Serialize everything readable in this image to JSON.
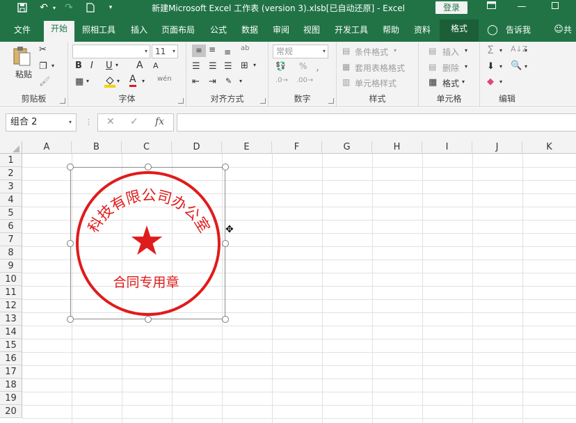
{
  "title_bar": {
    "title": "新建Microsoft Excel 工作表 (version 3).xlsb[已自动还原]  -  Excel",
    "login": "登录",
    "icons": [
      "save-icon",
      "undo-icon",
      "redo-icon",
      "new-document-icon",
      "customize-quick-access-icon"
    ]
  },
  "tabs": [
    {
      "label": "文件"
    },
    {
      "label": "开始"
    },
    {
      "label": "照相工具"
    },
    {
      "label": "插入"
    },
    {
      "label": "页面布局"
    },
    {
      "label": "公式"
    },
    {
      "label": "数据"
    },
    {
      "label": "审阅"
    },
    {
      "label": "视图"
    },
    {
      "label": "开发工具"
    },
    {
      "label": "帮助"
    },
    {
      "label": "资料"
    },
    {
      "label": "格式"
    },
    {
      "label": "告诉我"
    },
    {
      "label": "共"
    }
  ],
  "ribbon": {
    "clipboard": {
      "label": "剪贴板",
      "paste": "粘贴"
    },
    "font": {
      "label": "字体",
      "font_name": "",
      "font_size": "11",
      "bold": "B",
      "italic": "I",
      "underline": "U",
      "grow": "A",
      "shrink": "A",
      "color": "A",
      "phonetic": "wén"
    },
    "alignment": {
      "label": "对齐方式"
    },
    "number": {
      "label": "数字",
      "format": "常规",
      "percent": "%",
      "comma": ","
    },
    "styles": {
      "label": "样式",
      "conditional": "条件格式",
      "table": "套用表格格式",
      "cell_styles": "单元格样式"
    },
    "cells": {
      "label": "单元格",
      "insert": "插入",
      "delete": "删除",
      "format": "格式"
    },
    "editing": {
      "label": "编辑"
    }
  },
  "formula_bar": {
    "name_box": "组合 2",
    "cancel": "✕",
    "enter": "✓",
    "fx": "fx",
    "value": ""
  },
  "columns": [
    "A",
    "B",
    "C",
    "D",
    "E",
    "F",
    "G",
    "H",
    "I",
    "J",
    "K"
  ],
  "rows": [
    "1",
    "2",
    "3",
    "4",
    "5",
    "6",
    "7",
    "8",
    "9",
    "10",
    "11",
    "12",
    "13",
    "14",
    "15",
    "16",
    "17",
    "18",
    "19",
    "20"
  ],
  "seal": {
    "arc_text": "科技有限公司办公室",
    "bottom_text": "合同专用章",
    "star": "★",
    "color": "#e01b1b"
  }
}
